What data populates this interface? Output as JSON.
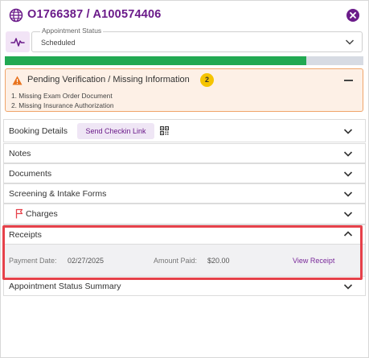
{
  "header": {
    "title": "O1766387 / A100574406",
    "icon": "globe-icon",
    "close_icon": "close-icon"
  },
  "status": {
    "legend": "Appointment Status",
    "value": "Scheduled"
  },
  "progress": {
    "fraction": 0.84,
    "fill_color": "#22a952",
    "track_color": "#d7dbe3"
  },
  "alert": {
    "title": "Pending Verification / Missing Information",
    "badge": "2",
    "items": [
      "1. Missing Exam Order Document",
      "2. Missing Insurance Authorization"
    ]
  },
  "sections": {
    "booking": {
      "label": "Booking Details",
      "checkin_button": "Send Checkin Link"
    },
    "notes": {
      "label": "Notes"
    },
    "documents": {
      "label": "Documents"
    },
    "screening": {
      "label": "Screening & Intake Forms"
    },
    "charges": {
      "label": "Charges"
    },
    "receipts": {
      "label": "Receipts",
      "payment_date_label": "Payment Date:",
      "payment_date": "02/27/2025",
      "amount_paid_label": "Amount Paid:",
      "amount_paid": "$20.00",
      "view_link": "View Receipt"
    },
    "status_summary": {
      "label": "Appointment Status Summary"
    }
  },
  "colors": {
    "brand": "#6b1b8a",
    "highlight": "#e6414a",
    "warning": "#f0a56a",
    "badge": "#f5c400"
  }
}
